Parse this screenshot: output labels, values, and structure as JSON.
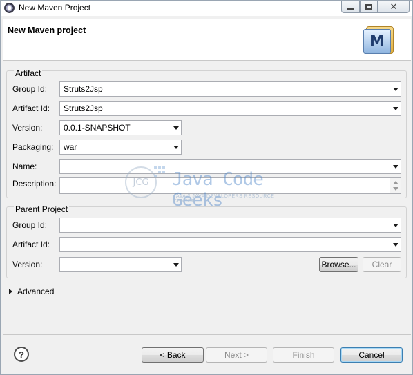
{
  "window": {
    "title": "New Maven Project",
    "close_glyph": "✕"
  },
  "banner": {
    "title": "New Maven project",
    "logo_letter": "M"
  },
  "artifact": {
    "legend": "Artifact",
    "group_id_label": "Group Id:",
    "group_id_value": "Struts2Jsp",
    "artifact_id_label": "Artifact Id:",
    "artifact_id_value": "Struts2Jsp",
    "version_label": "Version:",
    "version_value": "0.0.1-SNAPSHOT",
    "packaging_label": "Packaging:",
    "packaging_value": "war",
    "name_label": "Name:",
    "name_value": "",
    "description_label": "Description:",
    "description_value": ""
  },
  "parent": {
    "legend": "Parent Project",
    "group_id_label": "Group Id:",
    "group_id_value": "",
    "artifact_id_label": "Artifact Id:",
    "artifact_id_value": "",
    "version_label": "Version:",
    "version_value": "",
    "browse_label": "Browse...",
    "clear_label": "Clear"
  },
  "advanced": {
    "label": "Advanced"
  },
  "watermark": {
    "logo": "JCG",
    "title": "Java Code Geeks",
    "subtitle": "JAVA 2 JAVA DEVELOPERS RESOURCE CENTER"
  },
  "footer": {
    "help_glyph": "?",
    "back_label": "< Back",
    "next_label": "Next >",
    "finish_label": "Finish",
    "cancel_label": "Cancel"
  },
  "icons": {
    "app": "eclipse-icon",
    "help": "help-icon",
    "logo": "maven-logo-icon"
  }
}
